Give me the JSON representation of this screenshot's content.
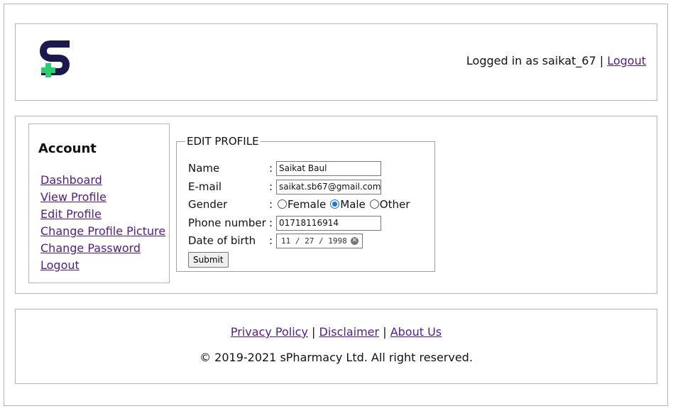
{
  "header": {
    "logged_in_text": "Logged in as saikat_67",
    "separator": "|",
    "logout_label": "Logout",
    "logo_color": "#1a1a4e",
    "cross_color": "#2ecc71"
  },
  "sidebar": {
    "title": "Account",
    "items": [
      {
        "label": "Dashboard"
      },
      {
        "label": "View Profile"
      },
      {
        "label": "Edit Profile"
      },
      {
        "label": "Change Profile Picture"
      },
      {
        "label": "Change Password"
      },
      {
        "label": "Logout"
      }
    ]
  },
  "form": {
    "legend": "EDIT PROFILE",
    "name_label": "Name",
    "name_value": "Saikat Baul",
    "email_label": "E-mail",
    "email_value": "saikat.sb67@gmail.com",
    "gender_label": "Gender",
    "gender_options": [
      "Female",
      "Male",
      "Other"
    ],
    "gender_selected": "Male",
    "phone_label": "Phone number",
    "phone_value": "01718116914",
    "dob_label": "Date of birth",
    "dob_value": "11 / 27 / 1998",
    "colon": ":",
    "submit_label": "Submit"
  },
  "footer": {
    "links": [
      "Privacy Policy",
      "Disclaimer",
      "About Us"
    ],
    "separator": "|",
    "copyright": "© 2019-2021 sPharmacy Ltd. All right reserved."
  }
}
